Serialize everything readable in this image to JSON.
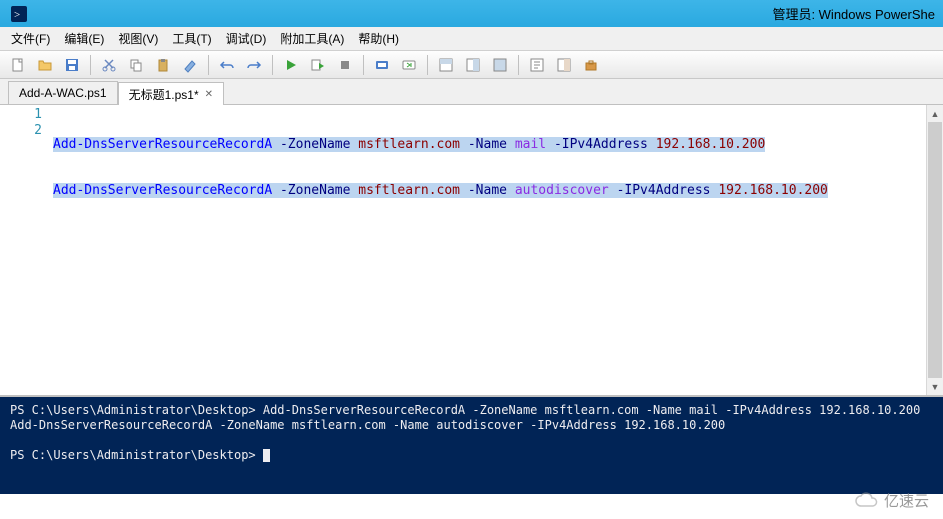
{
  "titlebar": {
    "text": "管理员: Windows PowerShe"
  },
  "menu": {
    "file": "文件(F)",
    "edit": "编辑(E)",
    "view": "视图(V)",
    "tools": "工具(T)",
    "debug": "调试(D)",
    "addons": "附加工具(A)",
    "help": "帮助(H)"
  },
  "tabs": {
    "tab1": "Add-A-WAC.ps1",
    "tab2": "无标题1.ps1*",
    "close": "✕"
  },
  "editor": {
    "gutter": [
      "1",
      "2"
    ],
    "line1": {
      "cmd": "Add-DnsServerResourceRecordA",
      "p1": "-ZoneName",
      "v1": "msftlearn.com",
      "p2": "-Name",
      "v2": "mail",
      "p3": "-IPv4Address",
      "v3": "192.168.10.200"
    },
    "line2": {
      "cmd": "Add-DnsServerResourceRecordA",
      "p1": "-ZoneName",
      "v1": "msftlearn.com",
      "p2": "-Name",
      "v2": "autodiscover",
      "p3": "-IPv4Address",
      "v3": "192.168.10.200"
    }
  },
  "console": {
    "l1": "PS C:\\Users\\Administrator\\Desktop> Add-DnsServerResourceRecordA -ZoneName msftlearn.com -Name mail -IPv4Address 192.168.10.200",
    "l2": "Add-DnsServerResourceRecordA -ZoneName msftlearn.com -Name autodiscover -IPv4Address 192.168.10.200",
    "l3": "",
    "l4": "PS C:\\Users\\Administrator\\Desktop>"
  },
  "watermark": {
    "text": "亿速云"
  }
}
